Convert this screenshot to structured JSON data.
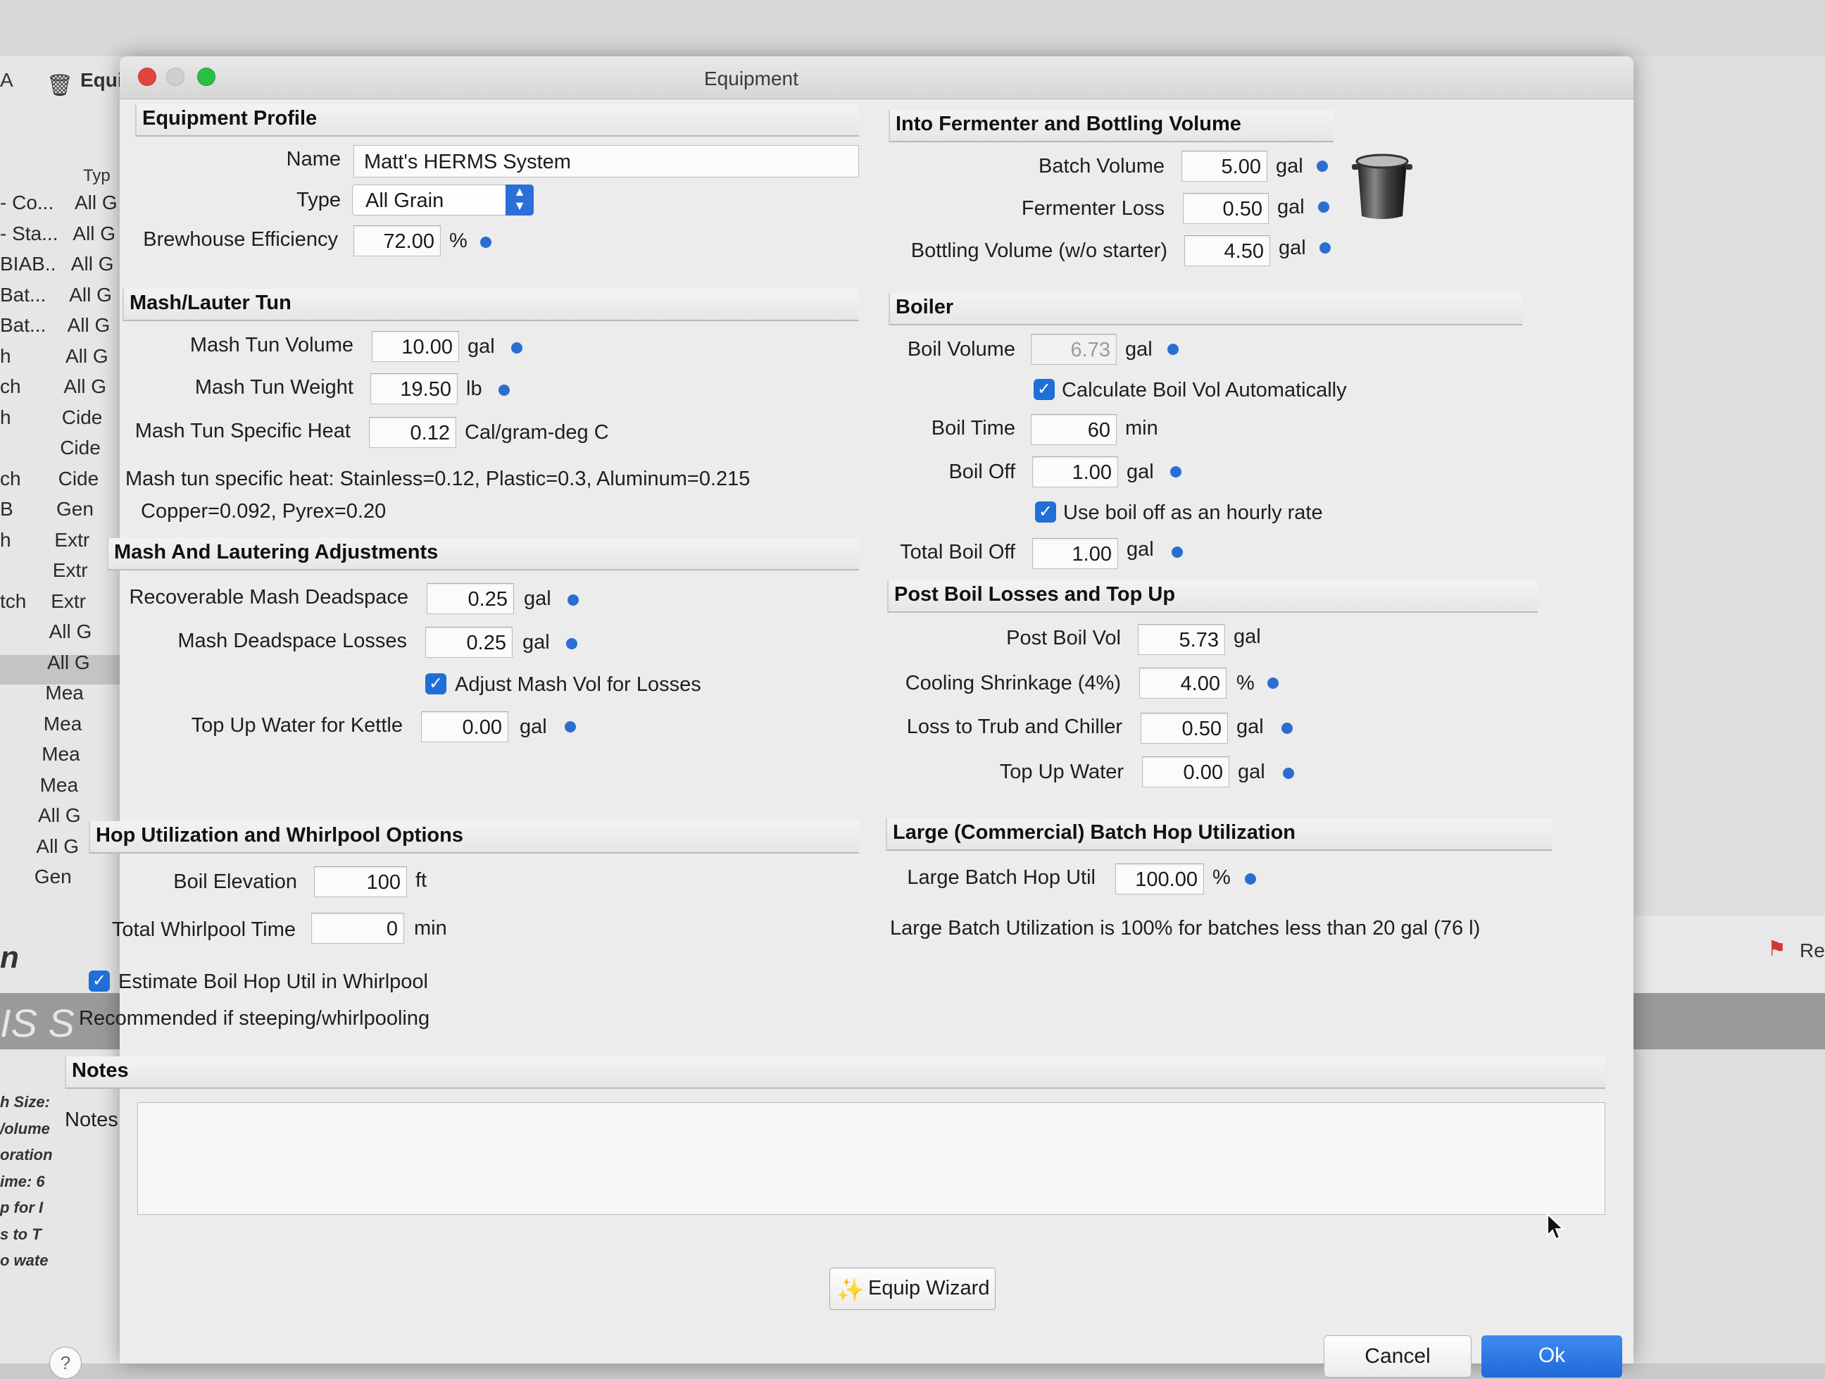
{
  "window": {
    "title": "Equipment"
  },
  "background": {
    "top_left": "A",
    "tab_label": "Equi",
    "column_type": "Typ",
    "list_names": [
      "- Co...",
      "- Sta...",
      "BIAB..",
      "Bat...",
      "Bat...",
      "h",
      "ch",
      "h",
      "",
      "ch",
      "B",
      "h",
      "",
      "tch",
      "",
      "",
      "",
      "",
      "",
      "",
      "",
      "",
      ""
    ],
    "list_types": [
      "All G",
      "All G",
      "All G",
      "All G",
      "All G",
      "All G",
      "All G",
      "Cide",
      "Cide",
      "Cide",
      "Gen",
      "Extr",
      "Extr",
      "Extr",
      "All G",
      "All G",
      "Mea",
      "Mea",
      "Mea",
      "Mea",
      "All G",
      "All G",
      "Gen"
    ],
    "bold_n": "n",
    "bar_text": "IS S",
    "italic_labels": [
      "h Size:",
      "/olume",
      "oration",
      "ime: 6",
      "p for I",
      "s to T",
      "o wate"
    ],
    "right_text": "Re"
  },
  "equipment_profile": {
    "header": "Equipment Profile",
    "name_label": "Name",
    "name_value": "Matt's HERMS System",
    "type_label": "Type",
    "type_value": "All Grain",
    "efficiency_label": "Brewhouse Efficiency",
    "efficiency_value": "72.00",
    "efficiency_unit": "%"
  },
  "mash_tun": {
    "header": "Mash/Lauter Tun",
    "volume_label": "Mash Tun Volume",
    "volume_value": "10.00",
    "volume_unit": "gal",
    "weight_label": "Mash Tun Weight",
    "weight_value": "19.50",
    "weight_unit": "lb",
    "heat_label": "Mash Tun Specific Heat",
    "heat_value": "0.12",
    "heat_unit": "Cal/gram-deg C",
    "note_line1": "Mash tun specific heat: Stainless=0.12, Plastic=0.3, Aluminum=0.215",
    "note_line2": "Copper=0.092, Pyrex=0.20"
  },
  "mash_adjustments": {
    "header": "Mash And Lautering Adjustments",
    "recoverable_label": "Recoverable Mash Deadspace",
    "recoverable_value": "0.25",
    "recoverable_unit": "gal",
    "losses_label": "Mash Deadspace Losses",
    "losses_value": "0.25",
    "losses_unit": "gal",
    "adjust_label": "Adjust Mash Vol for Losses",
    "topup_label": "Top Up Water for Kettle",
    "topup_value": "0.00",
    "topup_unit": "gal"
  },
  "hop_utilization": {
    "header": "Hop Utilization and Whirlpool Options",
    "elevation_label": "Boil Elevation",
    "elevation_value": "100",
    "elevation_unit": "ft",
    "whirlpool_label": "Total Whirlpool Time",
    "whirlpool_value": "0",
    "whirlpool_unit": "min",
    "estimate_label": "Estimate Boil Hop Util in Whirlpool",
    "recommend_text": "Recommended if steeping/whirlpooling"
  },
  "fermenter": {
    "header": "Into Fermenter and Bottling Volume",
    "batch_label": "Batch Volume",
    "batch_value": "5.00",
    "batch_unit": "gal",
    "loss_label": "Fermenter Loss",
    "loss_value": "0.50",
    "loss_unit": "gal",
    "bottling_label": "Bottling Volume (w/o starter)",
    "bottling_value": "4.50",
    "bottling_unit": "gal"
  },
  "boiler": {
    "header": "Boiler",
    "volume_label": "Boil Volume",
    "volume_value": "6.73",
    "volume_unit": "gal",
    "calc_label": "Calculate Boil Vol Automatically",
    "time_label": "Boil Time",
    "time_value": "60",
    "time_unit": "min",
    "off_label": "Boil Off",
    "off_value": "1.00",
    "off_unit": "gal",
    "hourly_label": "Use boil off as an hourly rate",
    "total_label": "Total Boil Off",
    "total_value": "1.00",
    "total_unit": "gal"
  },
  "post_boil": {
    "header": "Post Boil Losses and Top Up",
    "vol_label": "Post Boil Vol",
    "vol_value": "5.73",
    "vol_unit": "gal",
    "cooling_label": "Cooling Shrinkage (4%)",
    "cooling_value": "4.00",
    "cooling_unit": "%",
    "trub_label": "Loss to Trub and Chiller",
    "trub_value": "0.50",
    "trub_unit": "gal",
    "topup_label": "Top Up Water",
    "topup_value": "0.00",
    "topup_unit": "gal"
  },
  "large_batch": {
    "header": "Large (Commercial) Batch Hop Utilization",
    "util_label": "Large Batch Hop Util",
    "util_value": "100.00",
    "util_unit": "%",
    "note": "Large Batch Utilization is 100% for batches less than 20 gal (76 l)"
  },
  "notes": {
    "header": "Notes",
    "label": "Notes",
    "value": ""
  },
  "buttons": {
    "wizard": "Equip Wizard",
    "cancel": "Cancel",
    "ok": "Ok",
    "help": "?"
  },
  "colors": {
    "accent": "#1f6fd6",
    "dot": "#2a6ed1"
  }
}
